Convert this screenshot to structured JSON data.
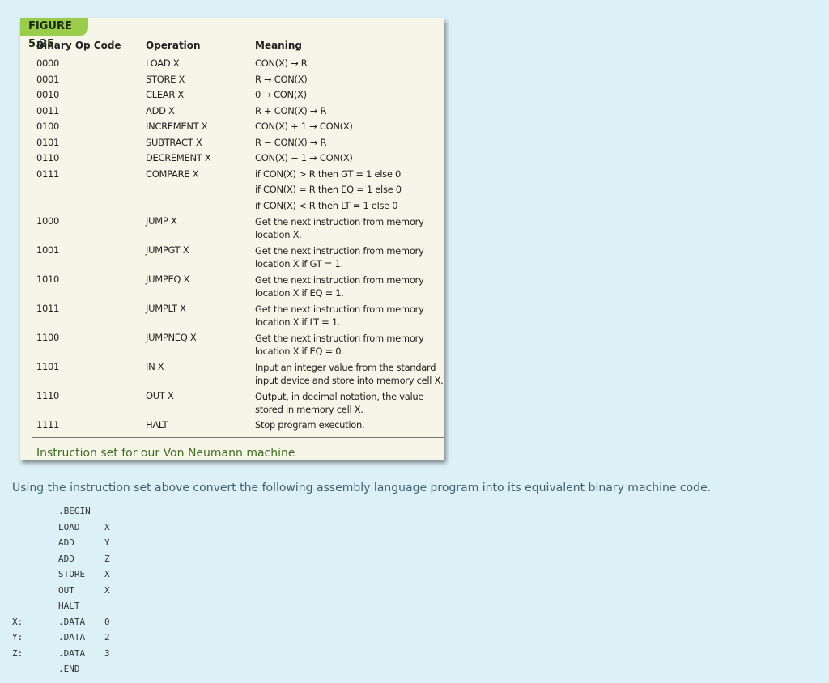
{
  "figure": {
    "label": "FIGURE 5.25",
    "headers": [
      "Binary Op Code",
      "Operation",
      "Meaning"
    ],
    "rows": [
      {
        "code": "0000",
        "op": "LOAD X",
        "meaning": [
          "CON(X) → R"
        ]
      },
      {
        "code": "0001",
        "op": "STORE X",
        "meaning": [
          "R → CON(X)"
        ]
      },
      {
        "code": "0010",
        "op": "CLEAR X",
        "meaning": [
          "0 → CON(X)"
        ]
      },
      {
        "code": "0011",
        "op": "ADD X",
        "meaning": [
          "R + CON(X) → R"
        ]
      },
      {
        "code": "0100",
        "op": "INCREMENT X",
        "meaning": [
          "CON(X) + 1 → CON(X)"
        ]
      },
      {
        "code": "0101",
        "op": "SUBTRACT X",
        "meaning": [
          "R − CON(X) → R"
        ]
      },
      {
        "code": "0110",
        "op": "DECREMENT X",
        "meaning": [
          "CON(X) − 1 → CON(X)"
        ]
      },
      {
        "code": "0111",
        "op": "COMPARE X",
        "meaning": [
          "if CON(X) > R then GT = 1 else 0",
          "if CON(X) = R then EQ = 1 else 0",
          "if CON(X) < R then LT = 1 else 0"
        ]
      },
      {
        "code": "1000",
        "op": "JUMP X",
        "meaning": [
          "Get the next instruction from memory",
          "location X."
        ]
      },
      {
        "code": "1001",
        "op": "JUMPGT X",
        "meaning": [
          "Get the next instruction from memory",
          "location X if GT = 1."
        ]
      },
      {
        "code": "1010",
        "op": "JUMPEQ X",
        "meaning": [
          "Get the next instruction from memory",
          "location X if EQ = 1."
        ]
      },
      {
        "code": "1011",
        "op": "JUMPLT X",
        "meaning": [
          "Get the next instruction from memory",
          "location X if LT = 1."
        ]
      },
      {
        "code": "1100",
        "op": "JUMPNEQ X",
        "meaning": [
          "Get the next instruction from memory",
          "location X if EQ = 0."
        ]
      },
      {
        "code": "1101",
        "op": "IN X",
        "meaning": [
          "Input an integer value from the standard",
          "input device and store into memory cell X."
        ]
      },
      {
        "code": "1110",
        "op": "OUT X",
        "meaning": [
          "Output, in decimal notation, the value",
          "stored in memory cell X."
        ]
      },
      {
        "code": "1111",
        "op": "HALT",
        "meaning": [
          "Stop program execution."
        ]
      }
    ],
    "caption": "Instruction set for our Von Neumann machine"
  },
  "question": "Using the instruction set above convert the following assembly language program into its equivalent binary machine code.",
  "program": [
    {
      "label": "",
      "op": ".BEGIN",
      "arg": ""
    },
    {
      "label": "",
      "op": "LOAD",
      "arg": "X"
    },
    {
      "label": "",
      "op": "ADD",
      "arg": "Y"
    },
    {
      "label": "",
      "op": "ADD",
      "arg": "Z"
    },
    {
      "label": "",
      "op": "STORE",
      "arg": "X"
    },
    {
      "label": "",
      "op": "OUT",
      "arg": "X"
    },
    {
      "label": "",
      "op": "HALT",
      "arg": ""
    },
    {
      "label": "X:",
      "op": ".DATA",
      "arg": "0"
    },
    {
      "label": "Y:",
      "op": ".DATA",
      "arg": "2"
    },
    {
      "label": "Z:",
      "op": ".DATA",
      "arg": "3"
    },
    {
      "label": "",
      "op": ".END",
      "arg": ""
    }
  ]
}
